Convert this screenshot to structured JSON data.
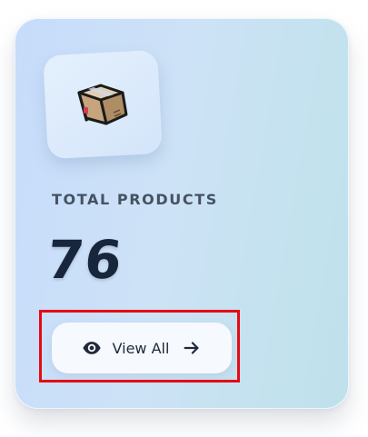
{
  "card": {
    "label": "TOTAL PRODUCTS",
    "value": "76",
    "icon": "package-box-icon",
    "button": {
      "label": "View All",
      "leading_icon": "eye-icon",
      "trailing_icon": "arrow-right-icon"
    }
  },
  "colors": {
    "label_text": "#445262",
    "value_text": "#17263a",
    "button_bg": "#f6f9fe",
    "highlight_border": "#e60a14"
  }
}
